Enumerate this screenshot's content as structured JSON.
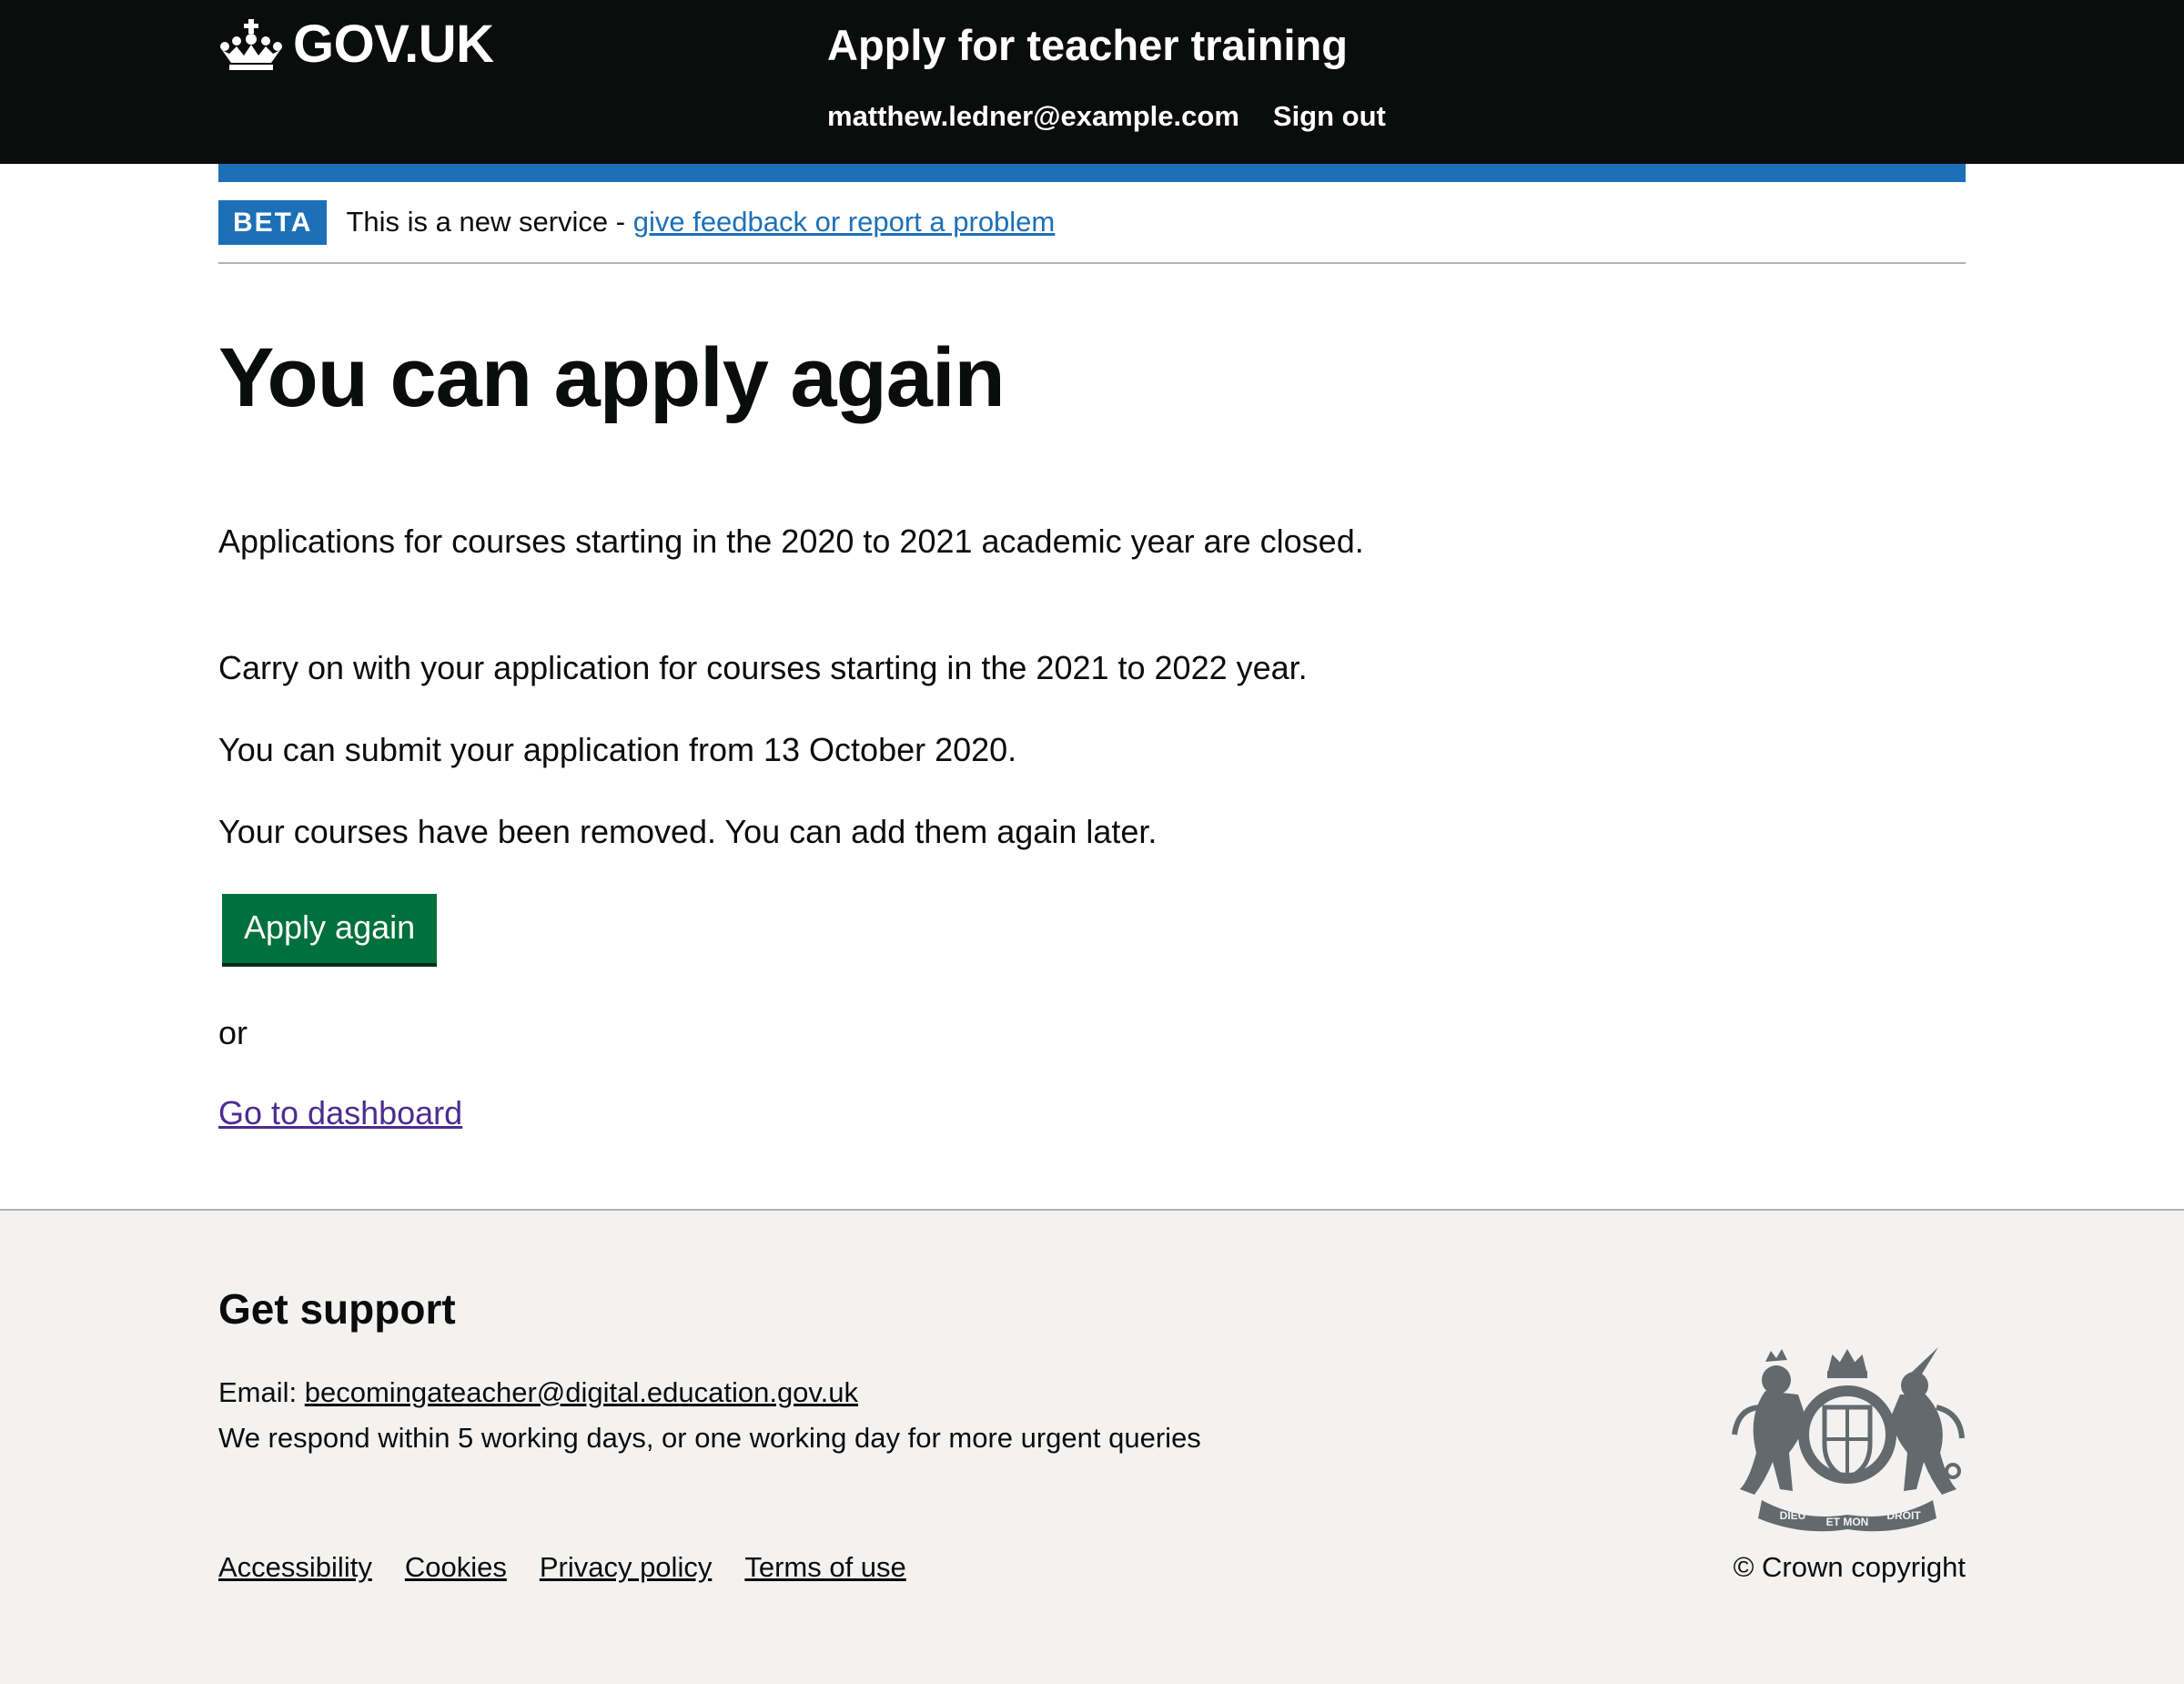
{
  "header": {
    "logo_text": "GOV.UK",
    "logo_icon": "crown-icon",
    "service_name": "Apply for teacher training",
    "nav": {
      "email": "matthew.ledner@example.com",
      "sign_out": "Sign out"
    }
  },
  "phase_banner": {
    "tag": "BETA",
    "text": "This is a new service - ",
    "link": "give feedback or report a problem"
  },
  "main": {
    "heading": "You can apply again",
    "paragraphs": [
      "Applications for courses starting in the 2020 to 2021 academic year are closed.",
      "Carry on with your application for courses starting in the 2021 to 2022 year.",
      "You can submit your application from 13 October 2020.",
      "Your courses have been removed. You can add them again later."
    ],
    "apply_button": "Apply again",
    "or_text": "or",
    "dashboard_link": "Go to dashboard"
  },
  "footer": {
    "heading": "Get support",
    "email_label": "Email: ",
    "email": "becomingateacher@digital.education.gov.uk",
    "response_text": "We respond within 5 working days, or one working day for more urgent queries",
    "links": [
      "Accessibility",
      "Cookies",
      "Privacy policy",
      "Terms of use"
    ],
    "crest_icon": "royal-coat-of-arms-icon",
    "crest_motto": [
      "DIEU",
      "ET MON",
      "DROIT"
    ],
    "copyright": "© Crown copyright"
  },
  "colors": {
    "header_bg": "#0b0c0c",
    "brand_blue": "#1d70b8",
    "button_green": "#00703c",
    "visited_link": "#4c2c92",
    "footer_bg": "#f3f2f1",
    "crest_grey": "#626a6e"
  }
}
